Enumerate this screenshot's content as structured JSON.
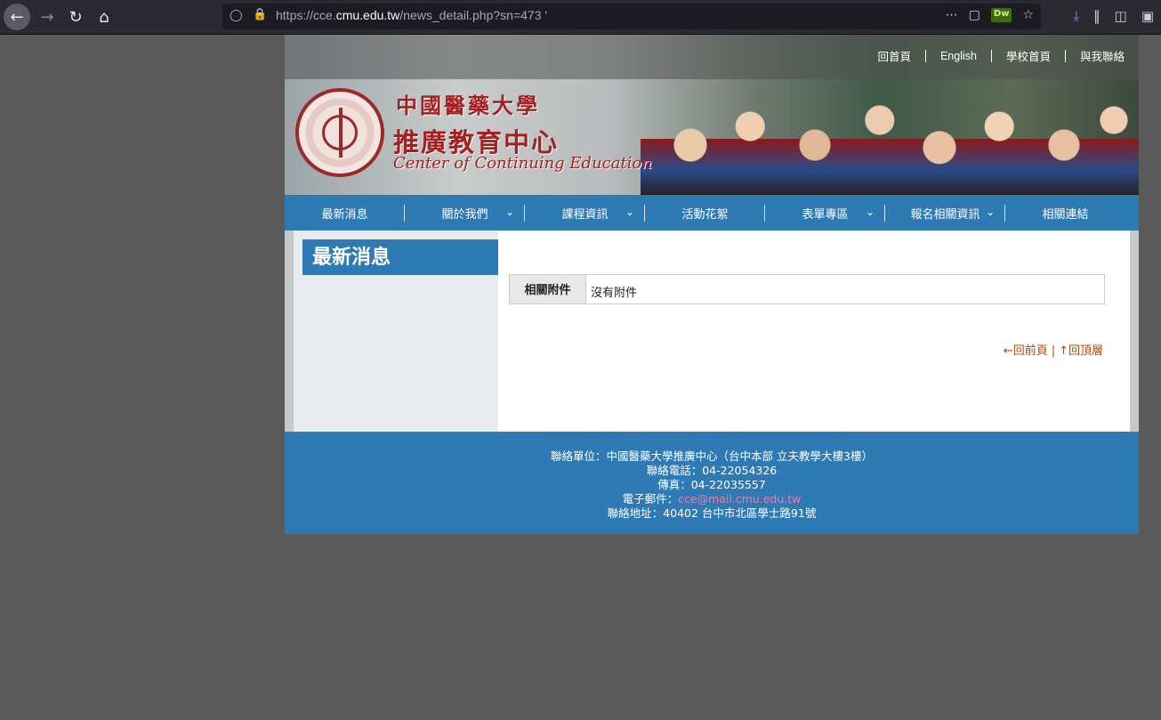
{
  "browser": {
    "url_prefix": "https://cce.",
    "url_domain": "cmu.edu.tw",
    "url_path": "/news_detail.php?sn=473 '"
  },
  "header": {
    "top_links": [
      "回首頁",
      "English",
      "學校首頁",
      "與我聯絡"
    ],
    "logo_line1": "中國醫藥大學",
    "logo_line2": "推廣教育中心",
    "logo_line3": "Center of Continuing Education"
  },
  "nav": [
    {
      "label": "最新消息",
      "dropdown": false
    },
    {
      "label": "關於我們",
      "dropdown": true
    },
    {
      "label": "課程資訊",
      "dropdown": true
    },
    {
      "label": "活動花絮",
      "dropdown": false
    },
    {
      "label": "表單專區",
      "dropdown": true
    },
    {
      "label": "報名相關資訊",
      "dropdown": true
    },
    {
      "label": "相關連結",
      "dropdown": false
    }
  ],
  "sidebar": {
    "title": "最新消息"
  },
  "main": {
    "attach_label": "相關附件",
    "attach_value": "沒有附件",
    "back_link": "←回前頁",
    "top_link": "↑回頂層"
  },
  "footer": {
    "line1": "聯絡單位：中國醫藥大學推廣中心（台中本部 立夫教學大樓3樓）",
    "line2": "聯絡電話：04-22054326",
    "line3": "傳真：04-22035557",
    "line4_label": "電子郵件：",
    "line4_email": "cce@mail.cmu.edu.tw",
    "line5": "聯絡地址：40402 台中市北區學士路91號"
  },
  "colors": {
    "nav_blue": "#2e7ab5",
    "logo_red": "#a52020",
    "link_orange": "#b5460a",
    "email_pink": "#f07aa8"
  }
}
